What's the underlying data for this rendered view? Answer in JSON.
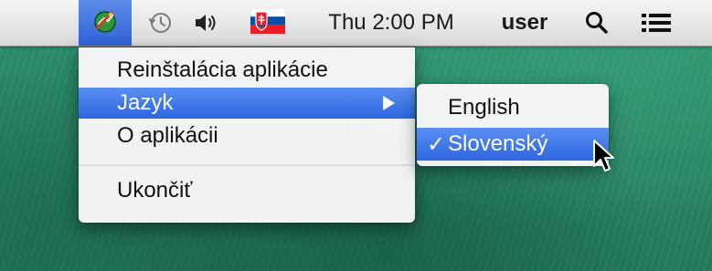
{
  "menubar": {
    "datetime": "Thu 2:00 PM",
    "user": "user",
    "icons": [
      "app-extra-icon",
      "time-machine-icon",
      "volume-icon",
      "slovak-flag-icon",
      "spotlight-search-icon",
      "notification-list-icon"
    ]
  },
  "menu": {
    "items": [
      {
        "label": "Reinštalácia aplikácie"
      },
      {
        "label": "Jazyk"
      },
      {
        "label": "O aplikácii"
      },
      {
        "label": "Ukončiť"
      }
    ]
  },
  "submenu": {
    "items": [
      {
        "label": "English",
        "checked": false
      },
      {
        "label": "Slovenský",
        "checked": true,
        "check_mark": "✓"
      }
    ]
  },
  "colors": {
    "highlight": "#2e66e0",
    "desktop": "#2a8764"
  }
}
